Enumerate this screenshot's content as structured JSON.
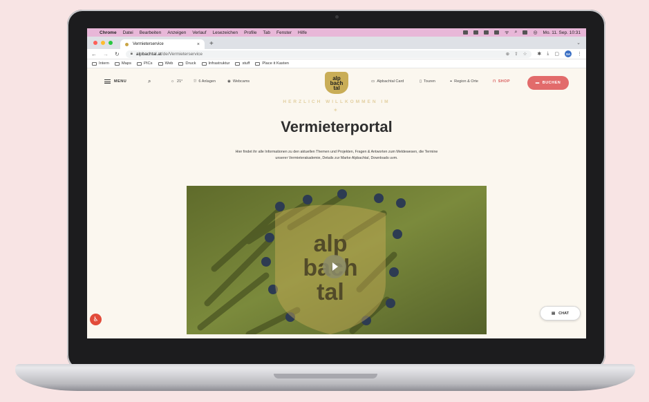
{
  "menubar": {
    "app": "Chrome",
    "items": [
      "Datei",
      "Bearbeiten",
      "Anzeigen",
      "Verlauf",
      "Lesezeichen",
      "Profile",
      "Tab",
      "Fenster",
      "Hilfe"
    ],
    "clock": "Mo. 11. Sep.  10:31"
  },
  "browser": {
    "tab_title": "Vermieterservice",
    "url_host": "alpbachtal.at",
    "url_path": "/de/Vermieterservice",
    "profile_initials": "SA",
    "bookmarks": [
      "Intern",
      "Maps",
      "PICs",
      "Web",
      "Druck",
      "Infrastruktur",
      "stuff",
      "Place it Kasten"
    ]
  },
  "site": {
    "menu_label": "MENU",
    "weather": "21°",
    "lifts": "6 Anlagen",
    "webcams": "Webcams",
    "logo": [
      "alp",
      "bach",
      "tal"
    ],
    "nav": {
      "card": "Alpbachtal Card",
      "touren": "Touren",
      "region": "Region & Orte",
      "shop": "SHOP",
      "book": "BUCHEN"
    },
    "welcome": "HERZLICH WILLKOMMEN IM",
    "title": "Vermieterportal",
    "intro": "Hier findet ihr alle Informationen zu den aktuellen Themen und Projekten, Fragen & Antworten zum Meldewesen, die Termine unserer Vermieterakademie, Details zur Marke Alpbachtal, Downloads uvm.",
    "video_logo": [
      "alp",
      "bach",
      "tal"
    ],
    "chat_label": "CHAT"
  },
  "colors": {
    "accent": "#e26b6b",
    "gold": "#c9ad57",
    "background": "#f8e4e4"
  }
}
